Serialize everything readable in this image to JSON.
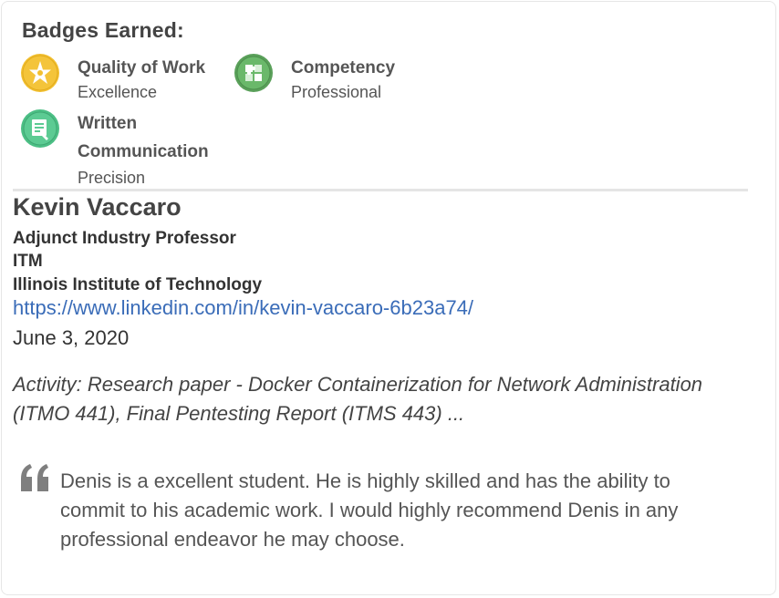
{
  "badges": {
    "title": "Badges Earned:",
    "items": [
      {
        "name": "Quality of Work",
        "level": "Excellence",
        "icon": "star-icon",
        "color": "#f2c031"
      },
      {
        "name": "Competency",
        "level": "Professional",
        "icon": "puzzle-icon",
        "color": "#5aa05a"
      },
      {
        "name_line1": "Written",
        "name_line2": "Communication",
        "level": "Precision",
        "icon": "document-edit-icon",
        "color": "#4cbf85"
      }
    ]
  },
  "recommender": {
    "name": "Kevin Vaccaro",
    "title": "Adjunct Industry Professor",
    "department": "ITM",
    "institution": "Illinois Institute of Technology",
    "link": "https://www.linkedin.com/in/kevin-vaccaro-6b23a74/",
    "date": "June 3, 2020"
  },
  "activity": "Activity: Research paper - Docker Containerization for Network Administration (ITMO 441), Final Pentesting Report (ITMS 443) ...",
  "quote": "Denis is a excellent student. He is highly skilled and has the ability to commit to his academic work. I would highly recommend Denis in any professional endeavor he may choose.",
  "colors": {
    "link": "#3a6cb8",
    "divider": "#e5e5e5",
    "quote_mark": "#7f7f7f"
  }
}
